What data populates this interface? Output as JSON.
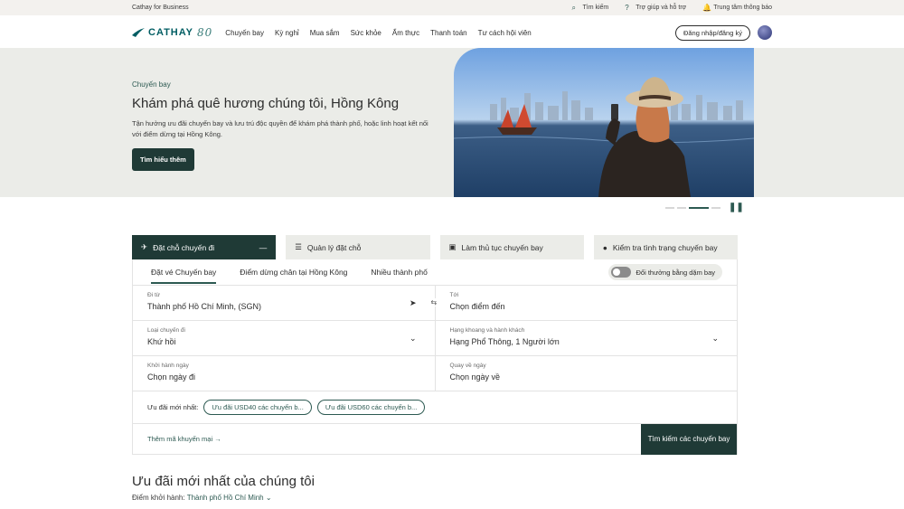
{
  "topbar": {
    "business": "Cathay for Business",
    "search": "Tìm kiếm",
    "help": "Trợ giúp và hỗ trợ",
    "notifications": "Trung tâm thông báo"
  },
  "nav": {
    "logo": "CATHAY",
    "logo_badge": "80",
    "links": [
      "Chuyến bay",
      "Kỳ nghỉ",
      "Mua sắm",
      "Sức khỏe",
      "Ẩm thực",
      "Thanh toán",
      "Tư cách hội viên"
    ],
    "login": "Đăng nhập/đăng ký"
  },
  "hero": {
    "tag": "Chuyến bay",
    "title": "Khám phá quê hương chúng tôi, Hồng Kông",
    "description": "Tận hưởng ưu đãi chuyến bay và lưu trú độc quyền để khám phá thành phố, hoặc linh hoạt kết nối với điểm dừng tại Hồng Kông.",
    "button": "Tìm hiểu thêm"
  },
  "booking": {
    "tabs": [
      {
        "label": "Đặt chỗ chuyến đi",
        "icon": "plane-icon"
      },
      {
        "label": "Quản lý đặt chỗ",
        "icon": "list-icon"
      },
      {
        "label": "Làm thủ tục chuyến bay",
        "icon": "checkin-icon"
      },
      {
        "label": "Kiểm tra tình trạng chuyến bay",
        "icon": "status-icon"
      }
    ],
    "subtabs": [
      "Đặt vé Chuyến bay",
      "Điểm dừng chân tại Hồng Kông",
      "Nhiều thành phố"
    ],
    "redeem_miles": "Đổi thưởng bằng dặm bay",
    "from_label": "Đi từ",
    "from_value": "Thành phố Hồ Chí Minh, (SGN)",
    "to_label": "Tới",
    "to_value": "Chọn điểm đến",
    "trip_type_label": "Loại chuyến đi",
    "trip_type_value": "Khứ hồi",
    "cabin_label": "Hạng khoang và hành khách",
    "cabin_value": "Hạng Phổ Thông, 1 Người lớn",
    "depart_label": "Khởi hành ngày",
    "depart_value": "Chọn ngày đi",
    "return_label": "Quay về ngày",
    "return_value": "Chọn ngày về",
    "deals_label": "Ưu đãi mới nhất:",
    "deal_chips": [
      "Ưu đãi USD40 các chuyến b...",
      "Ưu đãi USD60 các chuyến b..."
    ],
    "promo_code": "Thêm mã khuyến mại →",
    "search_button": "Tìm kiếm các chuyến bay"
  },
  "offers": {
    "title": "Ưu đãi mới nhất của chúng tôi",
    "departure_label": "Điểm khởi hành:",
    "departure_city": "Thành phố Hồ Chí Minh"
  },
  "colors": {
    "brand_dark": "#1f3a36",
    "brand_teal": "#2d5a52",
    "hero_bg": "#ebece8"
  }
}
